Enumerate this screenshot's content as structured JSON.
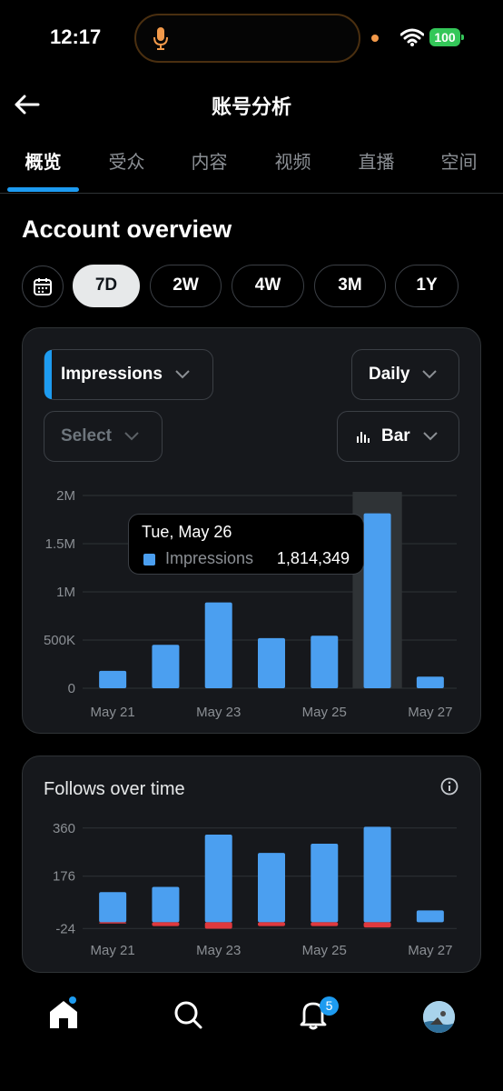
{
  "status_bar": {
    "time": "12:17",
    "battery": "100"
  },
  "header": {
    "title": "账号分析"
  },
  "tabs": [
    {
      "label": "概览"
    },
    {
      "label": "受众"
    },
    {
      "label": "内容"
    },
    {
      "label": "视频"
    },
    {
      "label": "直播"
    },
    {
      "label": "空间"
    }
  ],
  "overview": {
    "title": "Account overview",
    "periods": [
      "7D",
      "2W",
      "4W",
      "3M",
      "1Y"
    ],
    "selected_period": "7D",
    "metric_dropdown": "Impressions",
    "interval_dropdown": "Daily",
    "compare_dropdown": "Select",
    "chart_type_dropdown": "Bar"
  },
  "impressions_tooltip": {
    "date": "Tue, May 26",
    "series": "Impressions",
    "value": "1,814,349"
  },
  "follows": {
    "title": "Follows over time"
  },
  "nav": {
    "notification_count": "5"
  },
  "colors": {
    "accent": "#1d9bf0",
    "bar": "#4b9ff0",
    "negative": "#e0393e",
    "card": "#16181c"
  },
  "chart_data": [
    {
      "type": "bar",
      "title": "",
      "series": [
        {
          "name": "Impressions",
          "values": [
            180000,
            450000,
            890000,
            520000,
            545000,
            1814349,
            120000
          ]
        }
      ],
      "categories": [
        "May 21",
        "May 22",
        "May 23",
        "May 24",
        "May 25",
        "May 26",
        "May 27"
      ],
      "x_tick_labels": [
        "May 21",
        "May 23",
        "May 25",
        "May 27"
      ],
      "y_ticks": [
        0,
        500000,
        1000000,
        1500000,
        2000000
      ],
      "y_tick_labels": [
        "0",
        "500K",
        "1M",
        "1.5M",
        "2M"
      ],
      "ylim": [
        0,
        2000000
      ],
      "highlighted_category": "May 26",
      "grid": true
    },
    {
      "type": "bar",
      "title": "Follows over time",
      "categories": [
        "May 21",
        "May 22",
        "May 23",
        "May 24",
        "May 25",
        "May 26",
        "May 27"
      ],
      "series": [
        {
          "values": [
            115,
            135,
            335,
            265,
            300,
            365,
            45
          ]
        },
        {
          "values": [
            -5,
            -15,
            -25,
            -15,
            -15,
            -20,
            0
          ]
        }
      ],
      "x_tick_labels": [
        "May 21",
        "May 23",
        "May 25",
        "May 27"
      ],
      "y_ticks": [
        -24,
        176,
        360
      ],
      "y_tick_labels": [
        "-24",
        "176",
        "360"
      ],
      "ylim": [
        -30,
        380
      ],
      "grid": true
    }
  ]
}
